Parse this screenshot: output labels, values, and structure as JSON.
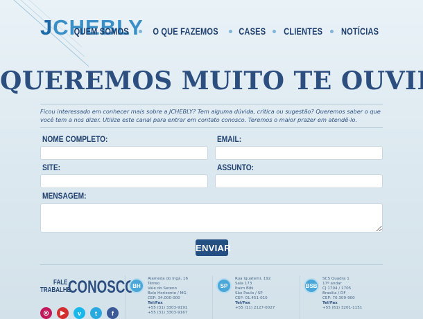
{
  "brand": {
    "logo_j": "J",
    "logo_rest": "CHEBLY"
  },
  "nav": [
    "QUEM SOMOS",
    "O QUE FAZEMOS",
    "CASES",
    "CLIENTES",
    "NOTÍCIAS"
  ],
  "headline": "QUEREMOS MUITO TE OUVIR",
  "intro": "Ficou interessado em conhecer mais sobre a JCHEBLY? Tem alguma dúvida, crítica ou sugestão? Queremos saber o que você tem a nos dizer. Utilize este canal para entrar em contato conosco. Teremos o maior prazer em atendê-lo.",
  "form": {
    "name_label": "NOME COMPLETO:",
    "email_label": "EMAIL:",
    "site_label": "SITE:",
    "subject_label": "ASSUNTO:",
    "message_label": "MENSAGEM:",
    "name_value": "",
    "email_value": "",
    "site_value": "",
    "subject_value": "",
    "message_value": "",
    "send_label": "ENVIAR"
  },
  "footer": {
    "fale": "FALE",
    "trabalhe": "TRABALHE",
    "conosco": "CONOSCO",
    "socials": [
      {
        "icon": "instagram-icon",
        "color": "#c2185b"
      },
      {
        "icon": "youtube-icon",
        "color": "#d32f2f"
      },
      {
        "icon": "vimeo-icon",
        "color": "#1ab7ea"
      },
      {
        "icon": "twitter-icon",
        "color": "#29a9e0"
      },
      {
        "icon": "facebook-icon",
        "color": "#3b5998"
      }
    ],
    "offices": [
      {
        "badge": "BH",
        "lines": [
          "Alameda do Ingá, 16",
          "Térreo",
          "Vale do Sereno",
          "Belo Horizonte / MG",
          "CEP: 34.000-000"
        ],
        "tel_label": "Tel/Fax",
        "phones": [
          "+55 (31) 3303-9191",
          "+55 (31) 3303-9167"
        ]
      },
      {
        "badge": "SP",
        "lines": [
          "Rua Iguatemi, 192",
          "Sala 173",
          "Itaim Bibi",
          "São Paulo / SP",
          "CEP: 01.451-010"
        ],
        "tel_label": "Tel/Fax",
        "phones": [
          "+55 (11) 2127-0027"
        ]
      },
      {
        "badge": "BSB",
        "lines": [
          "SCS Quadra 1",
          "17º andar",
          "CJ 1704 / 1705",
          "Brasília / DF",
          "CEP: 70.309-900"
        ],
        "tel_label": "Tel/Fax",
        "phones": [
          "+55 (61) 3201-1151"
        ]
      }
    ]
  }
}
